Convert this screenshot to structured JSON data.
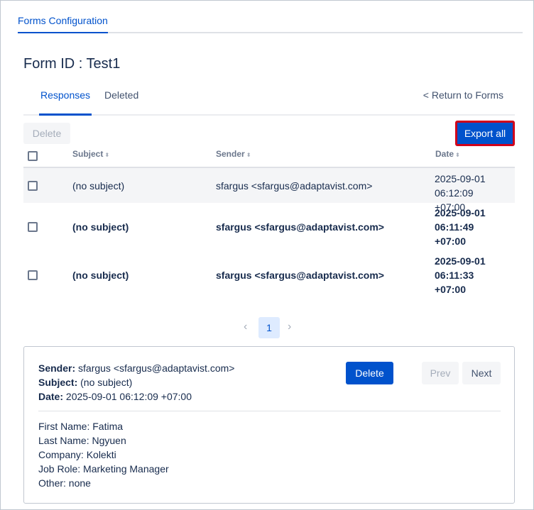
{
  "top_tab": "Forms Configuration",
  "form_title": "Form ID : Test1",
  "tabs": {
    "responses": "Responses",
    "deleted": "Deleted",
    "return": "< Return to Forms"
  },
  "toolbar": {
    "delete_label": "Delete",
    "export_label": "Export all"
  },
  "table": {
    "headers": {
      "subject": "Subject",
      "sender": "Sender",
      "date": "Date"
    },
    "sort_glyph": "⬍",
    "rows": [
      {
        "subject": "(no subject)",
        "sender": "sfargus <sfargus@adaptavist.com>",
        "date": "2025-09-01 06:12:09 +07:00",
        "read": true
      },
      {
        "subject": "(no subject)",
        "sender": "sfargus <sfargus@adaptavist.com>",
        "date": "2025-09-01 06:11:49 +07:00",
        "read": false
      },
      {
        "subject": "(no subject)",
        "sender": "sfargus <sfargus@adaptavist.com>",
        "date": "2025-09-01 06:11:33 +07:00",
        "read": false
      }
    ]
  },
  "pagination": {
    "current_page": "1",
    "prev_icon": "‹",
    "next_icon": "›"
  },
  "detail": {
    "sender_label": "Sender:",
    "sender_value": "sfargus <sfargus@adaptavist.com>",
    "subject_label": "Subject:",
    "subject_value": "(no subject)",
    "date_label": "Date:",
    "date_value": "2025-09-01 06:12:09 +07:00",
    "delete_label": "Delete",
    "prev_label": "Prev",
    "next_label": "Next",
    "fields": [
      "First Name: Fatima",
      "Last Name: Ngyuen",
      "Company: Kolekti",
      "Job Role: Marketing Manager",
      "Other: none"
    ]
  },
  "colors": {
    "accent": "#0052cc",
    "highlight_border": "#d0021b"
  }
}
